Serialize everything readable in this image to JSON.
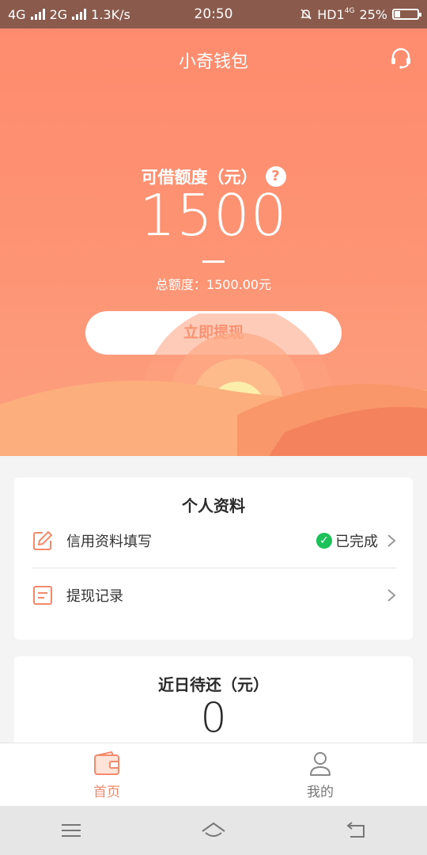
{
  "status_bar": {
    "sim1": "4G",
    "sim2": "2G",
    "speed": "1.3K/s",
    "time": "20:50",
    "hd": "HD1",
    "net_badge": "4G",
    "battery": "25%",
    "battery_level": 0.25
  },
  "header": {
    "title": "小奇钱包"
  },
  "credit": {
    "available_label": "可借额度（元）",
    "help_symbol": "?",
    "available_amount": "1500",
    "total_text": "总额度：1500.00元",
    "withdraw_button": "立即提现"
  },
  "profile_card": {
    "title": "个人资料",
    "items": [
      {
        "label": "信用资料填写",
        "status": "已完成",
        "icon": "edit-icon"
      },
      {
        "label": "提现记录",
        "status": "",
        "icon": "list-icon"
      }
    ]
  },
  "repay_card": {
    "title": "近日待还（元）",
    "amount": "0"
  },
  "tabbar": {
    "tabs": [
      {
        "label": "首页",
        "icon": "wallet-icon",
        "active": true
      },
      {
        "label": "我的",
        "icon": "user-icon",
        "active": false
      }
    ]
  },
  "colors": {
    "hero": "#fd8e6f",
    "accent": "#f6825f",
    "success": "#1cc159"
  }
}
